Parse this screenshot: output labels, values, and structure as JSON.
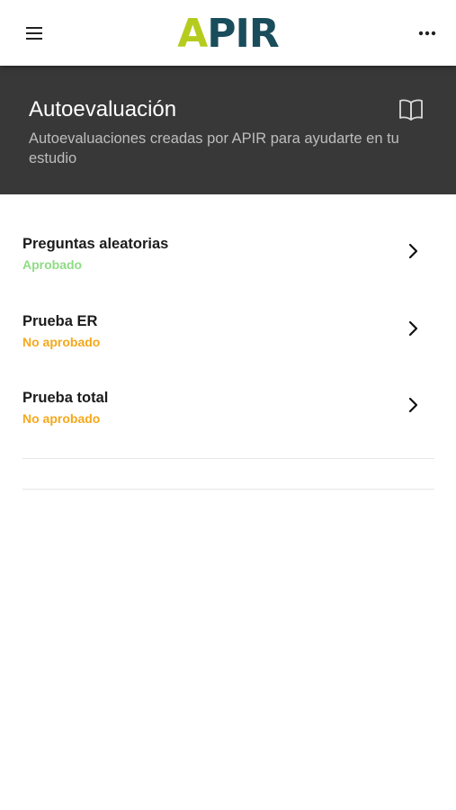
{
  "topbar": {
    "logo_a": "A",
    "logo_rest": "PIR",
    "menu_icon": "hamburger-menu-icon",
    "more_icon": "more-horizontal-icon"
  },
  "banner": {
    "title": "Autoevaluación",
    "subtitle": "Autoevaluaciones creadas por APIR para ayudarte en tu estudio",
    "icon": "open-book-icon"
  },
  "items": [
    {
      "title": "Preguntas aleatorias",
      "status": "Aprobado"
    },
    {
      "title": "Prueba ER",
      "status": "No aprobado"
    },
    {
      "title": "Prueba total",
      "status": "No aprobado"
    }
  ],
  "colors": {
    "banner_bg": "#383838",
    "logo_a": "#b5cc1f",
    "logo_rest": "#1a4d5c",
    "status_pass": "#8fdc85",
    "status_fail": "#f5a81a"
  }
}
